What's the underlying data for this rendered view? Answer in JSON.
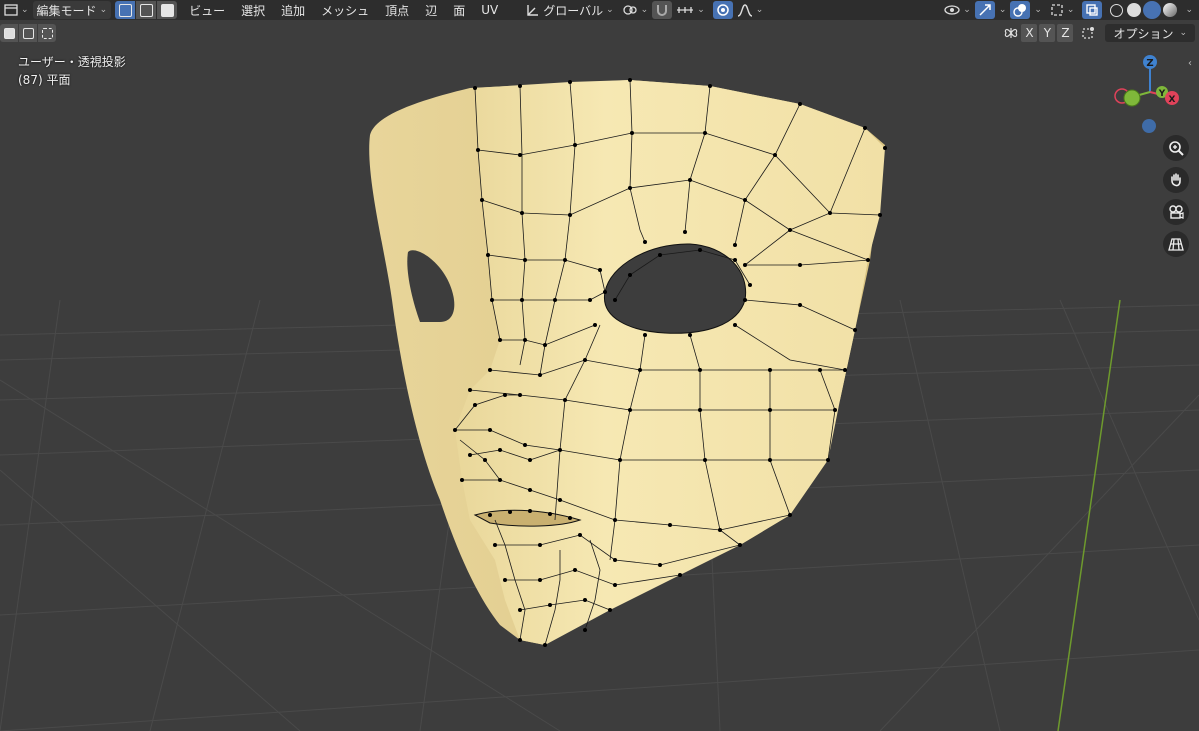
{
  "header": {
    "editor_icon": "editor-type-icon",
    "mode_label": "編集モード",
    "menus": [
      "ビュー",
      "選択",
      "追加",
      "メッシュ",
      "頂点",
      "辺",
      "面",
      "UV"
    ],
    "transform_orientation": "グローバル"
  },
  "viewport": {
    "view_name": "ユーザー・透視投影",
    "object_info": "(87) 平面"
  },
  "axis_toggles": [
    "X",
    "Y",
    "Z"
  ],
  "options_label": "オプション",
  "gizmo": {
    "z": "Z",
    "y": "Y",
    "x": "X"
  },
  "colors": {
    "header_bg": "#2d2d2d",
    "viewport_bg": "#3d3d3d",
    "accent": "#4772b3",
    "mesh_face": "#f4e4a8",
    "axis_x": "#e0425a",
    "axis_y": "#7fb83a",
    "axis_z": "#3f82d0"
  }
}
